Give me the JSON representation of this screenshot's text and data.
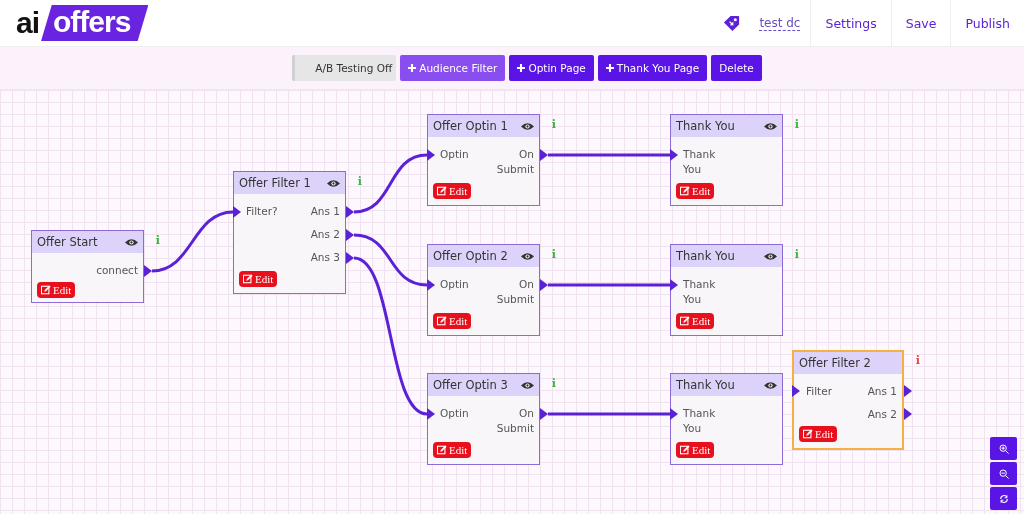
{
  "brand": {
    "prefix": "ai",
    "name": "offers"
  },
  "user": "test dc",
  "nav": [
    "Settings",
    "Save",
    "Publish"
  ],
  "toolbar": [
    {
      "label": "A/B Testing Off",
      "kind": "toggle",
      "hovered": false
    },
    {
      "label": "Audience Filter",
      "kind": "add",
      "hovered": true
    },
    {
      "label": "Optin Page",
      "kind": "add",
      "hovered": false
    },
    {
      "label": "Thank You Page",
      "kind": "add",
      "hovered": false
    },
    {
      "label": "Delete",
      "kind": "action",
      "hovered": false
    }
  ],
  "nodes": [
    {
      "title": "Offer Start",
      "outputs": [
        "connect"
      ],
      "edit": "Edit",
      "preview": true,
      "info": "i",
      "color": "#3cb43c",
      "selected": false
    },
    {
      "title": "Offer Filter 1",
      "inputs": [
        "Filter?"
      ],
      "outputs": [
        "Ans 1",
        "Ans 2",
        "Ans 3"
      ],
      "edit": "Edit",
      "preview": true,
      "info": "i",
      "color": "#3cb43c",
      "selected": false
    },
    {
      "title": "Offer Optin 1",
      "inputs": [
        "Optin"
      ],
      "outputs": [
        "On Submit"
      ],
      "edit": "Edit",
      "preview": true,
      "info": "i",
      "color": "#3cb43c",
      "selected": false
    },
    {
      "title": "Thank You",
      "inputs": [
        "Thank You"
      ],
      "edit": "Edit",
      "preview": true,
      "info": "i",
      "color": "#3cb43c",
      "selected": false
    },
    {
      "title": "Offer Optin 2",
      "inputs": [
        "Optin"
      ],
      "outputs": [
        "On Submit"
      ],
      "edit": "Edit",
      "preview": true,
      "info": "i",
      "color": "#3cb43c",
      "selected": false
    },
    {
      "title": "Thank You",
      "inputs": [
        "Thank You"
      ],
      "edit": "Edit",
      "preview": true,
      "info": "i",
      "color": "#3cb43c",
      "selected": false
    },
    {
      "title": "Offer Optin 3",
      "inputs": [
        "Optin"
      ],
      "outputs": [
        "On Submit"
      ],
      "edit": "Edit",
      "preview": true,
      "info": "i",
      "color": "#3cb43c",
      "selected": false
    },
    {
      "title": "Thank You",
      "inputs": [
        "Thank You"
      ],
      "edit": "Edit",
      "preview": true,
      "selected": false
    },
    {
      "title": "Offer Filter 2",
      "inputs": [
        "Filter"
      ],
      "outputs": [
        "Ans 1",
        "Ans 2"
      ],
      "edit": "Edit",
      "info": "i",
      "color": "#e04848",
      "selected": true
    }
  ]
}
